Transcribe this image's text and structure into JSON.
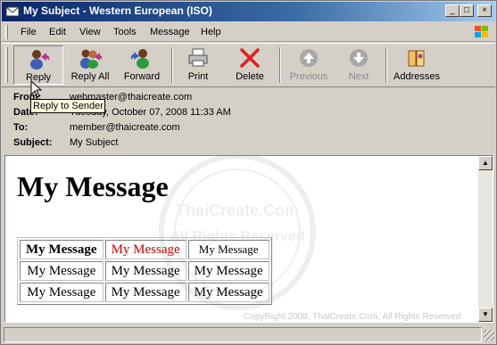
{
  "window": {
    "title": "My Subject - Western European (ISO)",
    "minimize_glyph": "_",
    "maximize_glyph": "□",
    "close_glyph": "×"
  },
  "menu": {
    "items": [
      {
        "label": "File"
      },
      {
        "label": "Edit"
      },
      {
        "label": "View"
      },
      {
        "label": "Tools"
      },
      {
        "label": "Message"
      },
      {
        "label": "Help"
      }
    ]
  },
  "toolbar": {
    "reply": "Reply",
    "reply_all": "Reply All",
    "forward": "Forward",
    "print": "Print",
    "delete": "Delete",
    "previous": "Previous",
    "next": "Next",
    "addresses": "Addresses"
  },
  "tooltip": {
    "text": "Reply to Sender"
  },
  "headers": {
    "from_label": "From:",
    "from_value": "webmaster@thaicreate.com",
    "date_label": "Date:",
    "date_value": "Tuesday, October 07, 2008 11:33 AM",
    "to_label": "To:",
    "to_value": "member@thaicreate.com",
    "subject_label": "Subject:",
    "subject_value": "My Subject"
  },
  "message": {
    "heading": "My Message",
    "table": [
      [
        "My Message",
        "My Message",
        "My Message"
      ],
      [
        "My Message",
        "My Message",
        "My Message"
      ],
      [
        "My Message",
        "My Message",
        "My Message"
      ]
    ],
    "copyright": "CopyRight 2009, ThaiCreate.Com, All Rights Reserved",
    "watermark_line1": "ThaiCreate.Com",
    "watermark_line2": "All Rights Reserved"
  },
  "scrollbar": {
    "up_glyph": "▲",
    "down_glyph": "▼"
  },
  "colors": {
    "title_gradient_start": "#0a246a",
    "title_gradient_end": "#a6caf0",
    "red_cell": "#cc0000",
    "tooltip_bg": "#ffffe1"
  }
}
